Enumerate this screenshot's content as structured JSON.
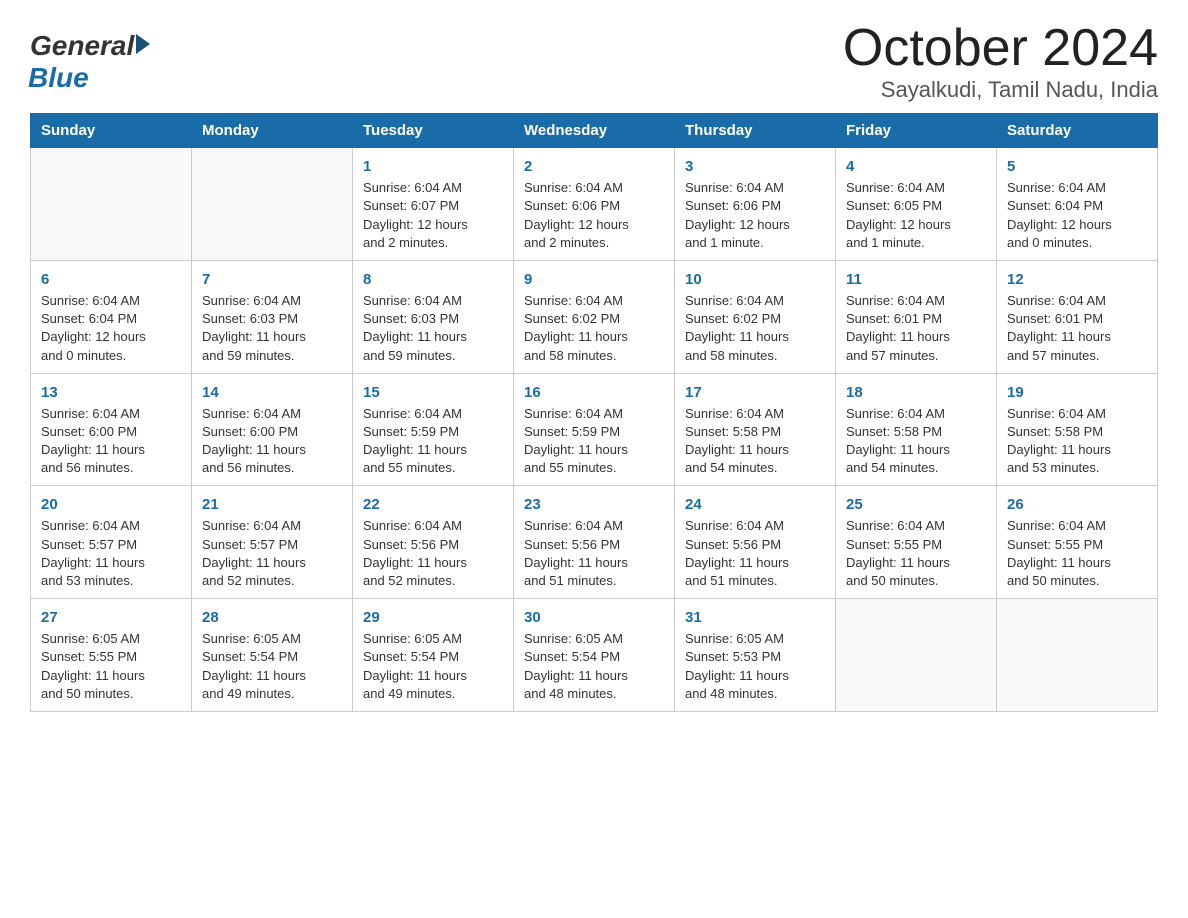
{
  "header": {
    "logo": {
      "general": "General",
      "blue": "Blue"
    },
    "title": "October 2024",
    "location": "Sayalkudi, Tamil Nadu, India"
  },
  "days_of_week": [
    "Sunday",
    "Monday",
    "Tuesday",
    "Wednesday",
    "Thursday",
    "Friday",
    "Saturday"
  ],
  "weeks": [
    [
      {
        "day": "",
        "info": ""
      },
      {
        "day": "",
        "info": ""
      },
      {
        "day": "1",
        "info": "Sunrise: 6:04 AM\nSunset: 6:07 PM\nDaylight: 12 hours\nand 2 minutes."
      },
      {
        "day": "2",
        "info": "Sunrise: 6:04 AM\nSunset: 6:06 PM\nDaylight: 12 hours\nand 2 minutes."
      },
      {
        "day": "3",
        "info": "Sunrise: 6:04 AM\nSunset: 6:06 PM\nDaylight: 12 hours\nand 1 minute."
      },
      {
        "day": "4",
        "info": "Sunrise: 6:04 AM\nSunset: 6:05 PM\nDaylight: 12 hours\nand 1 minute."
      },
      {
        "day": "5",
        "info": "Sunrise: 6:04 AM\nSunset: 6:04 PM\nDaylight: 12 hours\nand 0 minutes."
      }
    ],
    [
      {
        "day": "6",
        "info": "Sunrise: 6:04 AM\nSunset: 6:04 PM\nDaylight: 12 hours\nand 0 minutes."
      },
      {
        "day": "7",
        "info": "Sunrise: 6:04 AM\nSunset: 6:03 PM\nDaylight: 11 hours\nand 59 minutes."
      },
      {
        "day": "8",
        "info": "Sunrise: 6:04 AM\nSunset: 6:03 PM\nDaylight: 11 hours\nand 59 minutes."
      },
      {
        "day": "9",
        "info": "Sunrise: 6:04 AM\nSunset: 6:02 PM\nDaylight: 11 hours\nand 58 minutes."
      },
      {
        "day": "10",
        "info": "Sunrise: 6:04 AM\nSunset: 6:02 PM\nDaylight: 11 hours\nand 58 minutes."
      },
      {
        "day": "11",
        "info": "Sunrise: 6:04 AM\nSunset: 6:01 PM\nDaylight: 11 hours\nand 57 minutes."
      },
      {
        "day": "12",
        "info": "Sunrise: 6:04 AM\nSunset: 6:01 PM\nDaylight: 11 hours\nand 57 minutes."
      }
    ],
    [
      {
        "day": "13",
        "info": "Sunrise: 6:04 AM\nSunset: 6:00 PM\nDaylight: 11 hours\nand 56 minutes."
      },
      {
        "day": "14",
        "info": "Sunrise: 6:04 AM\nSunset: 6:00 PM\nDaylight: 11 hours\nand 56 minutes."
      },
      {
        "day": "15",
        "info": "Sunrise: 6:04 AM\nSunset: 5:59 PM\nDaylight: 11 hours\nand 55 minutes."
      },
      {
        "day": "16",
        "info": "Sunrise: 6:04 AM\nSunset: 5:59 PM\nDaylight: 11 hours\nand 55 minutes."
      },
      {
        "day": "17",
        "info": "Sunrise: 6:04 AM\nSunset: 5:58 PM\nDaylight: 11 hours\nand 54 minutes."
      },
      {
        "day": "18",
        "info": "Sunrise: 6:04 AM\nSunset: 5:58 PM\nDaylight: 11 hours\nand 54 minutes."
      },
      {
        "day": "19",
        "info": "Sunrise: 6:04 AM\nSunset: 5:58 PM\nDaylight: 11 hours\nand 53 minutes."
      }
    ],
    [
      {
        "day": "20",
        "info": "Sunrise: 6:04 AM\nSunset: 5:57 PM\nDaylight: 11 hours\nand 53 minutes."
      },
      {
        "day": "21",
        "info": "Sunrise: 6:04 AM\nSunset: 5:57 PM\nDaylight: 11 hours\nand 52 minutes."
      },
      {
        "day": "22",
        "info": "Sunrise: 6:04 AM\nSunset: 5:56 PM\nDaylight: 11 hours\nand 52 minutes."
      },
      {
        "day": "23",
        "info": "Sunrise: 6:04 AM\nSunset: 5:56 PM\nDaylight: 11 hours\nand 51 minutes."
      },
      {
        "day": "24",
        "info": "Sunrise: 6:04 AM\nSunset: 5:56 PM\nDaylight: 11 hours\nand 51 minutes."
      },
      {
        "day": "25",
        "info": "Sunrise: 6:04 AM\nSunset: 5:55 PM\nDaylight: 11 hours\nand 50 minutes."
      },
      {
        "day": "26",
        "info": "Sunrise: 6:04 AM\nSunset: 5:55 PM\nDaylight: 11 hours\nand 50 minutes."
      }
    ],
    [
      {
        "day": "27",
        "info": "Sunrise: 6:05 AM\nSunset: 5:55 PM\nDaylight: 11 hours\nand 50 minutes."
      },
      {
        "day": "28",
        "info": "Sunrise: 6:05 AM\nSunset: 5:54 PM\nDaylight: 11 hours\nand 49 minutes."
      },
      {
        "day": "29",
        "info": "Sunrise: 6:05 AM\nSunset: 5:54 PM\nDaylight: 11 hours\nand 49 minutes."
      },
      {
        "day": "30",
        "info": "Sunrise: 6:05 AM\nSunset: 5:54 PM\nDaylight: 11 hours\nand 48 minutes."
      },
      {
        "day": "31",
        "info": "Sunrise: 6:05 AM\nSunset: 5:53 PM\nDaylight: 11 hours\nand 48 minutes."
      },
      {
        "day": "",
        "info": ""
      },
      {
        "day": "",
        "info": ""
      }
    ]
  ]
}
